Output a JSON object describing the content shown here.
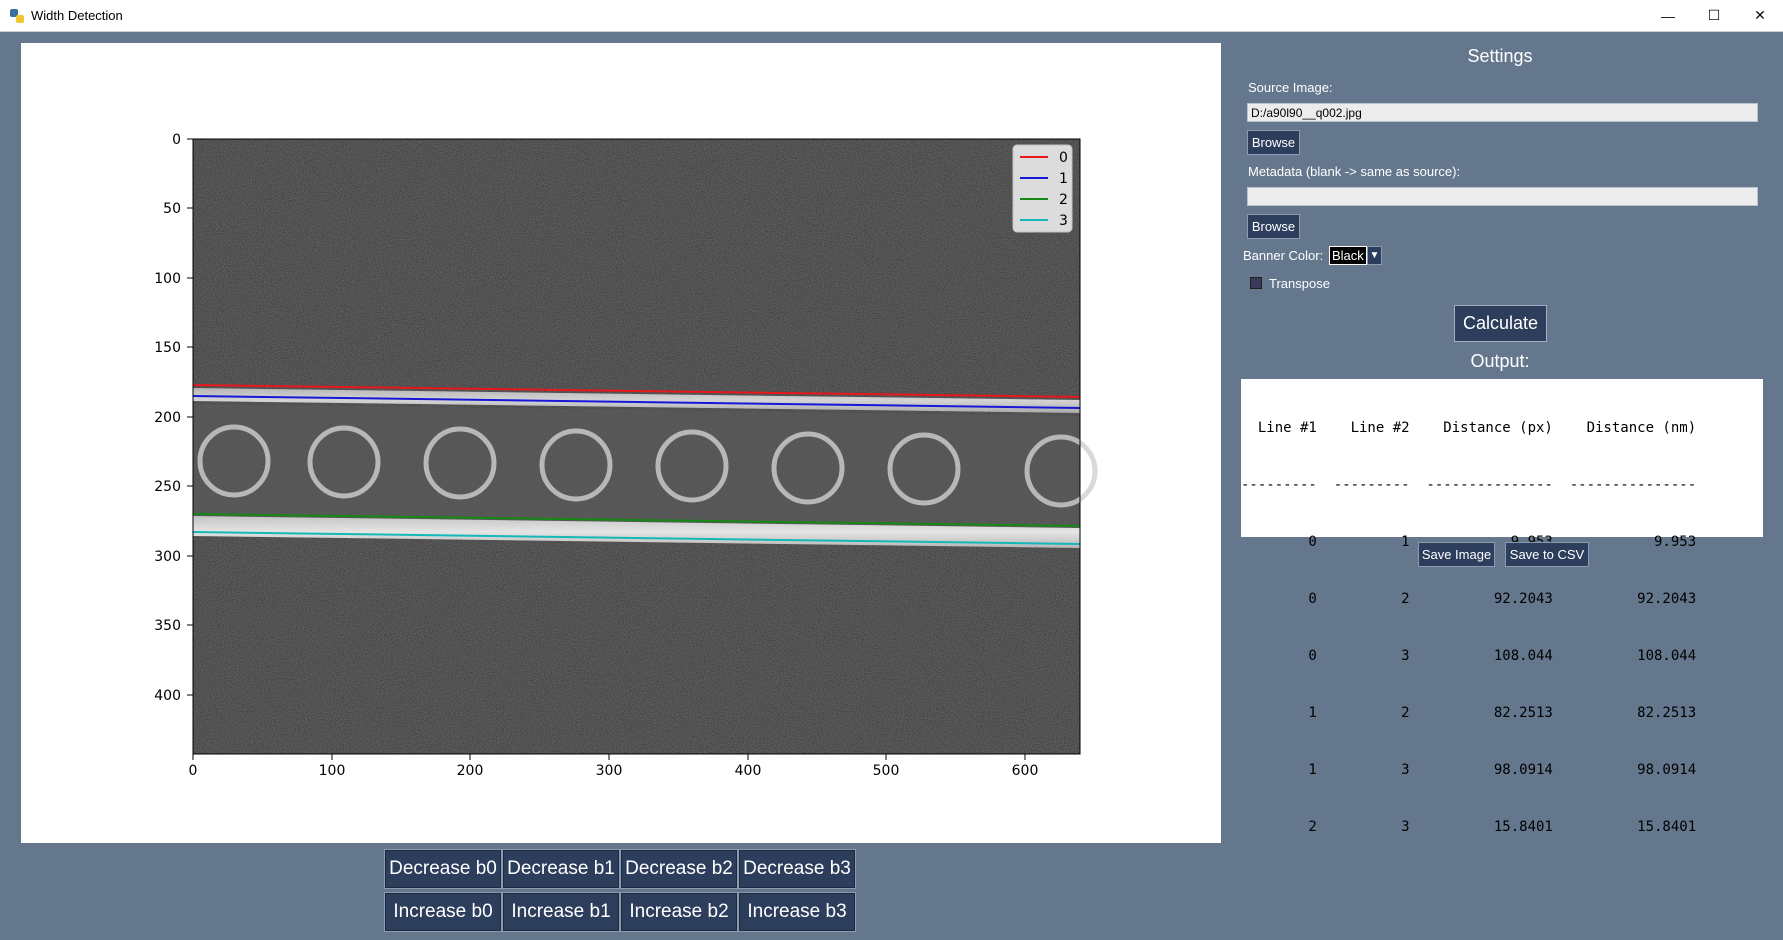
{
  "window": {
    "title": "Width Detection",
    "minimize_glyph": "—",
    "maximize_glyph": "☐",
    "close_glyph": "✕"
  },
  "plot": {
    "x_ticks": [
      "0",
      "100",
      "200",
      "300",
      "400",
      "500",
      "600"
    ],
    "y_ticks": [
      "0",
      "50",
      "100",
      "150",
      "200",
      "250",
      "300",
      "350",
      "400"
    ],
    "legend": [
      {
        "label": "0",
        "color": "#e8171c"
      },
      {
        "label": "1",
        "color": "#1717d8"
      },
      {
        "label": "2",
        "color": "#148a14"
      },
      {
        "label": "3",
        "color": "#15b8b8"
      }
    ]
  },
  "controls": {
    "decrease": [
      "Decrease b0",
      "Decrease b1",
      "Decrease b2",
      "Decrease b3"
    ],
    "increase": [
      "Increase b0",
      "Increase b1",
      "Increase b2",
      "Increase b3"
    ]
  },
  "settings": {
    "title": "Settings",
    "source_label": "Source Image:",
    "source_value": "D:/a90l90__q002.jpg",
    "browse_label": "Browse",
    "metadata_label": "Metadata (blank -> same as source):",
    "metadata_value": "",
    "banner_label": "Banner Color:",
    "banner_value": "Black",
    "transpose_label": "Transpose",
    "calculate_label": "Calculate",
    "output_title": "Output:",
    "save_image_label": "Save Image",
    "save_csv_label": "Save to CSV"
  },
  "output": {
    "header": "  Line #1    Line #2    Distance (px)    Distance (nm)",
    "separator": "---------  ---------  ---------------  ---------------",
    "rows": [
      "        0          1            9.953            9.953",
      "        0          2          92.2043          92.2043",
      "        0          3          108.044          108.044",
      "        1          2          82.2513          82.2513",
      "        1          3          98.0914          98.0914",
      "        2          3          15.8401          15.8401"
    ]
  },
  "colors": {
    "background": "#64778d",
    "button": "#2c3e5c"
  }
}
